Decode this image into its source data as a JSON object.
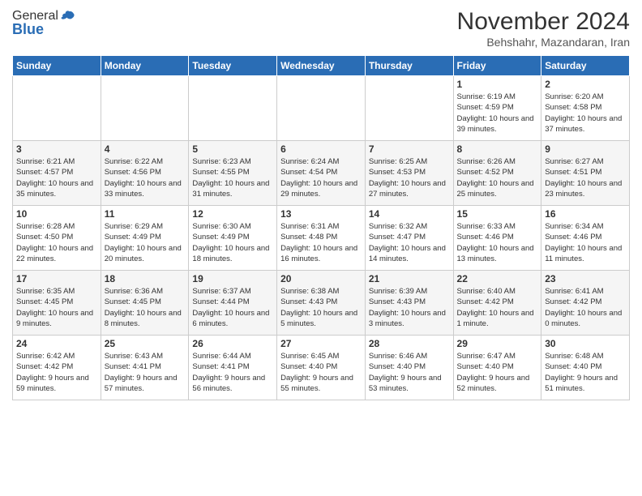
{
  "header": {
    "logo_general": "General",
    "logo_blue": "Blue",
    "month_title": "November 2024",
    "subtitle": "Behshahr, Mazandaran, Iran"
  },
  "days_of_week": [
    "Sunday",
    "Monday",
    "Tuesday",
    "Wednesday",
    "Thursday",
    "Friday",
    "Saturday"
  ],
  "weeks": [
    [
      {
        "day": "",
        "info": ""
      },
      {
        "day": "",
        "info": ""
      },
      {
        "day": "",
        "info": ""
      },
      {
        "day": "",
        "info": ""
      },
      {
        "day": "",
        "info": ""
      },
      {
        "day": "1",
        "info": "Sunrise: 6:19 AM\nSunset: 4:59 PM\nDaylight: 10 hours and 39 minutes."
      },
      {
        "day": "2",
        "info": "Sunrise: 6:20 AM\nSunset: 4:58 PM\nDaylight: 10 hours and 37 minutes."
      }
    ],
    [
      {
        "day": "3",
        "info": "Sunrise: 6:21 AM\nSunset: 4:57 PM\nDaylight: 10 hours and 35 minutes."
      },
      {
        "day": "4",
        "info": "Sunrise: 6:22 AM\nSunset: 4:56 PM\nDaylight: 10 hours and 33 minutes."
      },
      {
        "day": "5",
        "info": "Sunrise: 6:23 AM\nSunset: 4:55 PM\nDaylight: 10 hours and 31 minutes."
      },
      {
        "day": "6",
        "info": "Sunrise: 6:24 AM\nSunset: 4:54 PM\nDaylight: 10 hours and 29 minutes."
      },
      {
        "day": "7",
        "info": "Sunrise: 6:25 AM\nSunset: 4:53 PM\nDaylight: 10 hours and 27 minutes."
      },
      {
        "day": "8",
        "info": "Sunrise: 6:26 AM\nSunset: 4:52 PM\nDaylight: 10 hours and 25 minutes."
      },
      {
        "day": "9",
        "info": "Sunrise: 6:27 AM\nSunset: 4:51 PM\nDaylight: 10 hours and 23 minutes."
      }
    ],
    [
      {
        "day": "10",
        "info": "Sunrise: 6:28 AM\nSunset: 4:50 PM\nDaylight: 10 hours and 22 minutes."
      },
      {
        "day": "11",
        "info": "Sunrise: 6:29 AM\nSunset: 4:49 PM\nDaylight: 10 hours and 20 minutes."
      },
      {
        "day": "12",
        "info": "Sunrise: 6:30 AM\nSunset: 4:49 PM\nDaylight: 10 hours and 18 minutes."
      },
      {
        "day": "13",
        "info": "Sunrise: 6:31 AM\nSunset: 4:48 PM\nDaylight: 10 hours and 16 minutes."
      },
      {
        "day": "14",
        "info": "Sunrise: 6:32 AM\nSunset: 4:47 PM\nDaylight: 10 hours and 14 minutes."
      },
      {
        "day": "15",
        "info": "Sunrise: 6:33 AM\nSunset: 4:46 PM\nDaylight: 10 hours and 13 minutes."
      },
      {
        "day": "16",
        "info": "Sunrise: 6:34 AM\nSunset: 4:46 PM\nDaylight: 10 hours and 11 minutes."
      }
    ],
    [
      {
        "day": "17",
        "info": "Sunrise: 6:35 AM\nSunset: 4:45 PM\nDaylight: 10 hours and 9 minutes."
      },
      {
        "day": "18",
        "info": "Sunrise: 6:36 AM\nSunset: 4:45 PM\nDaylight: 10 hours and 8 minutes."
      },
      {
        "day": "19",
        "info": "Sunrise: 6:37 AM\nSunset: 4:44 PM\nDaylight: 10 hours and 6 minutes."
      },
      {
        "day": "20",
        "info": "Sunrise: 6:38 AM\nSunset: 4:43 PM\nDaylight: 10 hours and 5 minutes."
      },
      {
        "day": "21",
        "info": "Sunrise: 6:39 AM\nSunset: 4:43 PM\nDaylight: 10 hours and 3 minutes."
      },
      {
        "day": "22",
        "info": "Sunrise: 6:40 AM\nSunset: 4:42 PM\nDaylight: 10 hours and 1 minute."
      },
      {
        "day": "23",
        "info": "Sunrise: 6:41 AM\nSunset: 4:42 PM\nDaylight: 10 hours and 0 minutes."
      }
    ],
    [
      {
        "day": "24",
        "info": "Sunrise: 6:42 AM\nSunset: 4:42 PM\nDaylight: 9 hours and 59 minutes."
      },
      {
        "day": "25",
        "info": "Sunrise: 6:43 AM\nSunset: 4:41 PM\nDaylight: 9 hours and 57 minutes."
      },
      {
        "day": "26",
        "info": "Sunrise: 6:44 AM\nSunset: 4:41 PM\nDaylight: 9 hours and 56 minutes."
      },
      {
        "day": "27",
        "info": "Sunrise: 6:45 AM\nSunset: 4:40 PM\nDaylight: 9 hours and 55 minutes."
      },
      {
        "day": "28",
        "info": "Sunrise: 6:46 AM\nSunset: 4:40 PM\nDaylight: 9 hours and 53 minutes."
      },
      {
        "day": "29",
        "info": "Sunrise: 6:47 AM\nSunset: 4:40 PM\nDaylight: 9 hours and 52 minutes."
      },
      {
        "day": "30",
        "info": "Sunrise: 6:48 AM\nSunset: 4:40 PM\nDaylight: 9 hours and 51 minutes."
      }
    ]
  ]
}
